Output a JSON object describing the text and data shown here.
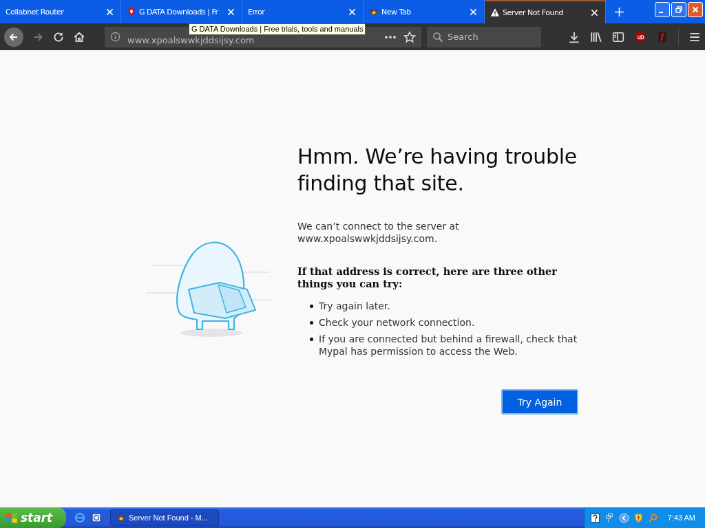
{
  "tabs": [
    {
      "title": "Collabnet Router",
      "kind": "plain",
      "selected": false
    },
    {
      "title": "G DATA Downloads | Fr",
      "kind": "shield",
      "selected": false
    },
    {
      "title": "Error",
      "kind": "plain",
      "selected": false
    },
    {
      "title": "New Tab",
      "kind": "creature",
      "selected": false
    },
    {
      "title": "Server Not Found",
      "kind": "warning",
      "selected": true
    }
  ],
  "tooltip": "G DATA Downloads | Free trials, tools and manuals",
  "address": {
    "url": "www.xpoalswwkjddsijsy.com"
  },
  "search": {
    "placeholder": "Search"
  },
  "error": {
    "heading": "Hmm. We’re having trouble finding that site.",
    "message": "We can’t connect to the server at www.xpoalswwkjddsijsy.com.",
    "subheading": "If that address is correct, here are three other things you can try:",
    "tips": [
      "Try again later.",
      "Check your network connection.",
      "If you are connected but behind a firewall, check that Mypal has permission to access the Web."
    ],
    "button": "Try Again"
  },
  "taskbar": {
    "start": "start",
    "task": "Server Not Found - M...",
    "clock": "7:43 AM"
  }
}
